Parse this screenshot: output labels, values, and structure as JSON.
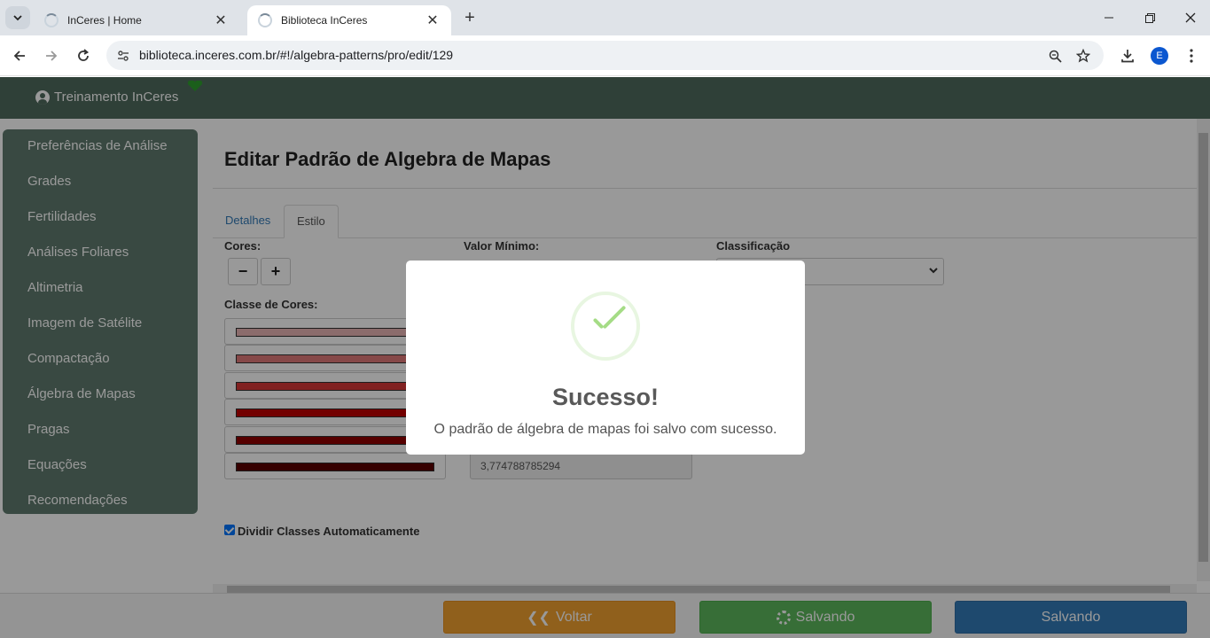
{
  "browser": {
    "tabs": [
      {
        "title": "InCeres | Home",
        "active": false
      },
      {
        "title": "Biblioteca InCeres",
        "active": true
      }
    ],
    "url": "biblioteca.inceres.com.br/#!/algebra-patterns/pro/edit/129",
    "profile_initial": "E"
  },
  "header": {
    "user": "Treinamento InCeres"
  },
  "sidebar": {
    "items": [
      {
        "label": "Preferências de Análise"
      },
      {
        "label": "Grades"
      },
      {
        "label": "Fertilidades"
      },
      {
        "label": "Análises Foliares"
      },
      {
        "label": "Altimetria"
      },
      {
        "label": "Imagem de Satélite"
      },
      {
        "label": "Compactação"
      },
      {
        "label": "Álgebra de Mapas"
      },
      {
        "label": "Pragas"
      },
      {
        "label": "Equações"
      },
      {
        "label": "Recomendações"
      }
    ]
  },
  "main": {
    "title": "Editar Padrão de Algebra de Mapas",
    "tabs": [
      {
        "label": "Detalhes",
        "active": false
      },
      {
        "label": "Estilo",
        "active": true
      }
    ],
    "cores_label": "Cores:",
    "minus_label": "−",
    "plus_label": "+",
    "valor_minimo_label": "Valor Mínimo:",
    "classificacao_label": "Classificação",
    "classe_cores_label": "Classe de Cores:",
    "swatches": [
      "#e8b4b4",
      "#e07878",
      "#d83838",
      "#c00000",
      "#900000",
      "#5a0000"
    ],
    "last_value": "3,774788785294",
    "auto_divide_label": "Dividir Classes Automaticamente",
    "auto_divide_checked": true
  },
  "footer": {
    "voltar": "Voltar",
    "salvando_1": "Salvando",
    "salvando_2": "Salvando"
  },
  "modal": {
    "title": "Sucesso!",
    "text": "O padrão de álgebra de mapas foi salvo com sucesso."
  },
  "colors": {
    "header_bg": "#4f6b5e",
    "sidebar_bg": "#5f7b6e",
    "success_green": "#a5dc86",
    "warning_orange": "#f0a030",
    "primary_blue": "#337ab7"
  }
}
